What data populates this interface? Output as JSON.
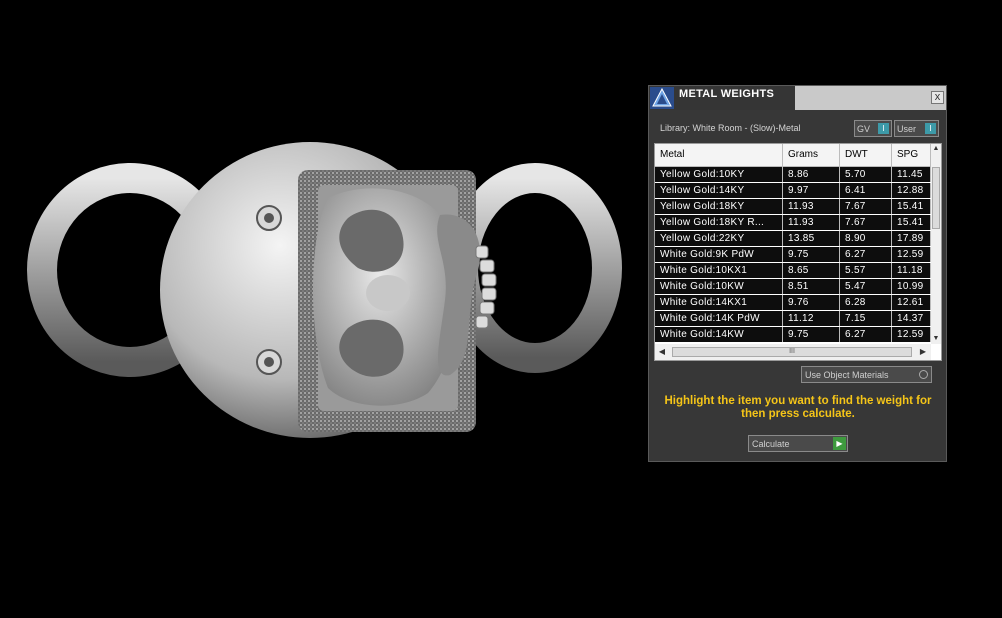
{
  "panel": {
    "title": "METAL WEIGHTS",
    "close_label": "x",
    "library_label": "Library: White Room - (Slow)-Metal",
    "toggles": [
      {
        "label": "GV",
        "state": "I"
      },
      {
        "label": "User",
        "state": "I"
      }
    ],
    "table": {
      "columns": [
        "Metal",
        "Grams",
        "DWT",
        "SPG"
      ],
      "rows": [
        [
          "Yellow Gold:10KY",
          "8.86",
          "5.70",
          "11.45"
        ],
        [
          "Yellow Gold:14KY",
          "9.97",
          "6.41",
          "12.88"
        ],
        [
          "Yellow Gold:18KY",
          "11.93",
          "7.67",
          "15.41"
        ],
        [
          "Yellow Gold:18KY R...",
          "11.93",
          "7.67",
          "15.41"
        ],
        [
          "Yellow Gold:22KY",
          "13.85",
          "8.90",
          "17.89"
        ],
        [
          "White Gold:9K PdW",
          "9.75",
          "6.27",
          "12.59"
        ],
        [
          "White Gold:10KX1",
          "8.65",
          "5.57",
          "11.18"
        ],
        [
          "White Gold:10KW",
          "8.51",
          "5.47",
          "10.99"
        ],
        [
          "White Gold:14KX1",
          "9.76",
          "6.28",
          "12.61"
        ],
        [
          "White Gold:14K PdW",
          "11.12",
          "7.15",
          "14.37"
        ],
        [
          "White Gold:14KW",
          "9.75",
          "6.27",
          "12.59"
        ]
      ],
      "hscroll_grip": "III"
    },
    "use_object_materials_label": "Use Object Materials",
    "instruction": "Highlight the item you want to find the weight for then press calculate.",
    "calculate_label": "Calculate"
  },
  "icons": {
    "app_logo": "app-logo-icon",
    "close": "close-icon",
    "go": "play-arrow-icon"
  },
  "colors": {
    "panel_bg": "#373737",
    "instruction_text": "#f5c518",
    "toggle_knob": "#3d9aa8",
    "calculate_go": "#3e9a3e"
  }
}
